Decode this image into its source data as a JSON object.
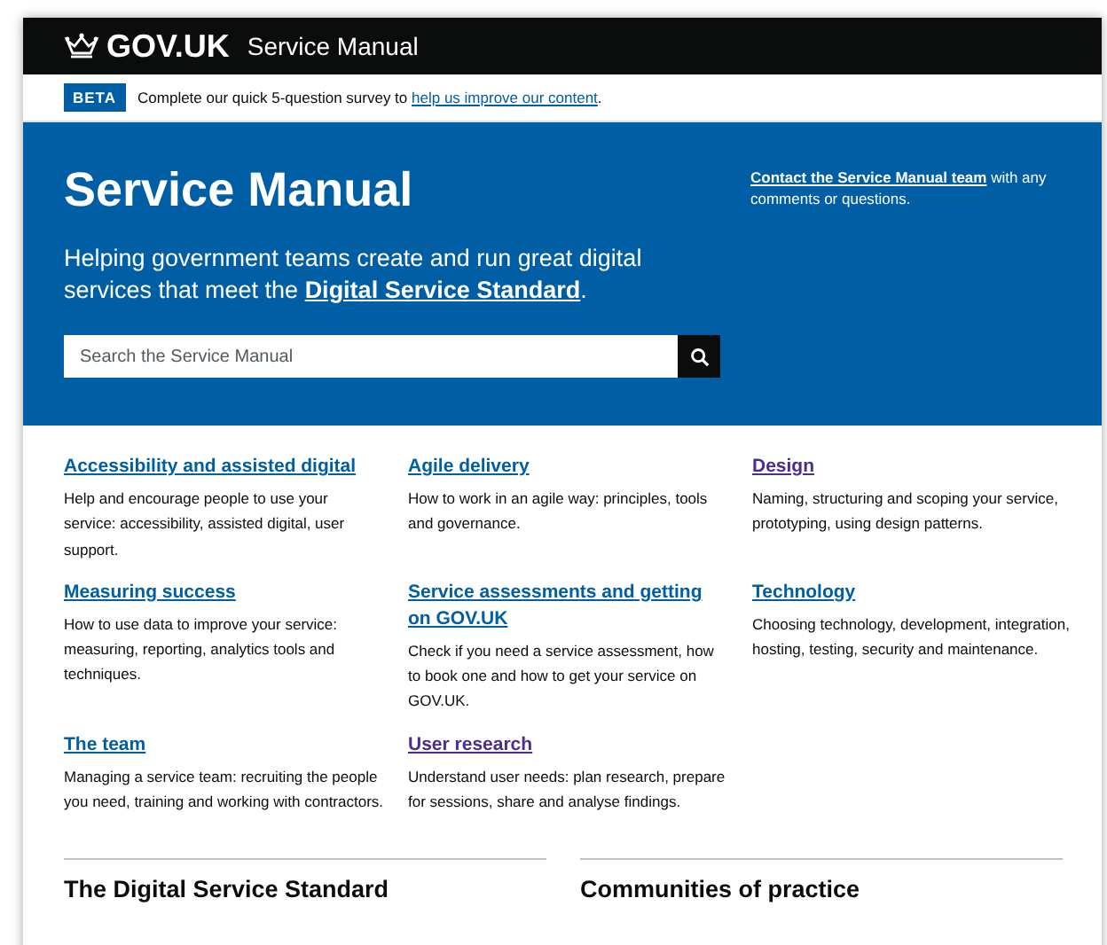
{
  "header": {
    "logo": "GOV.UK",
    "service": "Service Manual"
  },
  "beta": {
    "tag": "BETA",
    "text": "Complete our quick 5-question survey to ",
    "link": "help us improve our content",
    "after": "."
  },
  "hero": {
    "title": "Service Manual",
    "intro": "Helping government teams create and run great digital services that meet the ",
    "intro_link": "Digital Service Standard",
    "intro_after": ".",
    "contact_link": "Contact the Service Manual team",
    "contact_text": " with any comments or questions.",
    "search": {
      "placeholder": "Search the Service Manual"
    }
  },
  "topics": [
    {
      "title": "Accessibility and assisted digital",
      "description": "Help and encourage people to use your service: accessibility, assisted digital, user support.",
      "visited": false
    },
    {
      "title": "Agile delivery",
      "description": "How to work in an agile way: principles, tools and governance.",
      "visited": false
    },
    {
      "title": "Design",
      "description": "Naming, structuring and scoping your service, prototyping, using design patterns.",
      "visited": true
    },
    {
      "title": "Measuring success",
      "description": "How to use data to improve your service: measuring, reporting, analytics tools and techniques.",
      "visited": false
    },
    {
      "title": "Service assessments and getting on GOV.UK",
      "description": "Check if you need a service assessment, how to book one and how to get your service on GOV.UK.",
      "visited": false
    },
    {
      "title": "Technology",
      "description": "Choosing technology, development, integration, hosting, testing, security and maintenance.",
      "visited": false
    },
    {
      "title": "The team",
      "description": "Managing a service team: recruiting the people you need, training and working with contractors.",
      "visited": false
    },
    {
      "title": "User research",
      "description": "Understand user needs: plan research, prepare for sessions, share and analyse findings.",
      "visited": true
    }
  ],
  "sections": [
    "The Digital Service Standard",
    "Communities of practice"
  ]
}
